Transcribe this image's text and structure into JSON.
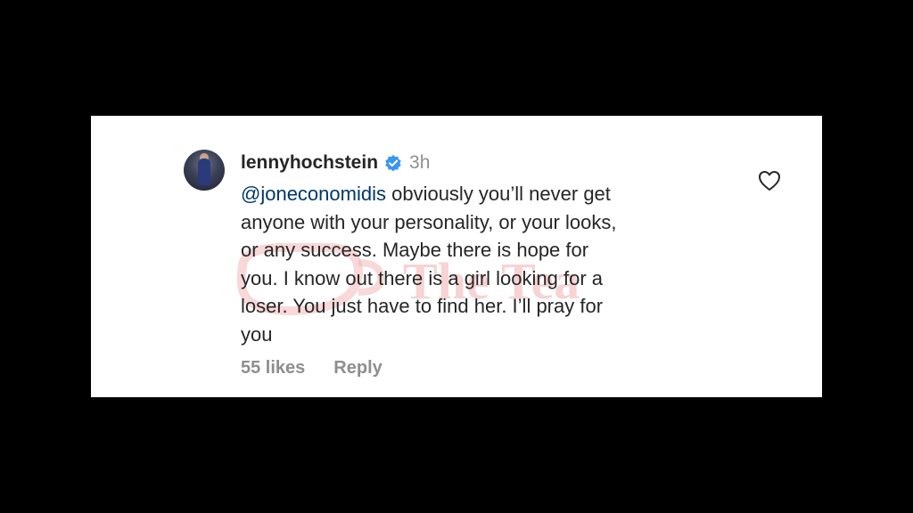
{
  "comment": {
    "username": "lennyhochstein",
    "time": "3h",
    "mention": "@joneconomidis",
    "text": " obviously you’ll never get\nanyone with your personality, or your looks,\nor any success. Maybe there is hope for\nyou. I know out there is a girl looking for a\nloser. You just have to find her. I’ll pray for\nyou",
    "likes": "55 likes",
    "reply": "Reply"
  },
  "icons": {
    "avatar": "profile-avatar",
    "verified": "verified-badge-icon",
    "like": "heart-outline-icon"
  },
  "colors": {
    "background": "#000000",
    "card": "#ffffff",
    "text": "#262626",
    "muted": "#8e8e8e",
    "mention": "#00376b",
    "verified": "#3897f0"
  },
  "watermark": {
    "text": "The Tea"
  }
}
